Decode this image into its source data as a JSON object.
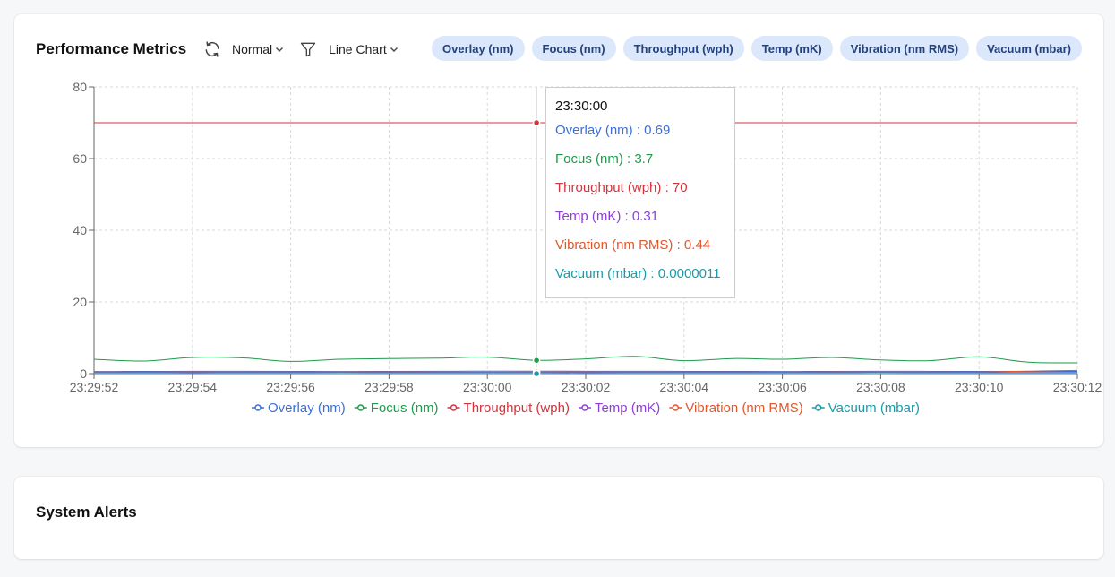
{
  "perf": {
    "title": "Performance Metrics",
    "mode_value": "Normal",
    "chart_type_value": "Line Chart",
    "chips": [
      "Overlay (nm)",
      "Focus (nm)",
      "Throughput (wph)",
      "Temp (mK)",
      "Vibration (nm RMS)",
      "Vacuum (mbar)"
    ]
  },
  "alerts": {
    "title": "System Alerts"
  },
  "icons": {
    "refresh": "refresh-icon",
    "filter": "filter-icon",
    "chevron": "chevron-down-icon"
  },
  "chart_data": {
    "type": "line",
    "x": [
      "23:29:52",
      "23:29:53",
      "23:29:54",
      "23:29:55",
      "23:29:56",
      "23:29:57",
      "23:29:58",
      "23:29:59",
      "23:30:00",
      "23:30:01",
      "23:30:02",
      "23:30:03",
      "23:30:04",
      "23:30:05",
      "23:30:06",
      "23:30:07",
      "23:30:08",
      "23:30:09",
      "23:30:10",
      "23:30:11",
      "23:30:12"
    ],
    "x_ticks": [
      "23:29:52",
      "23:29:54",
      "23:29:56",
      "23:29:58",
      "23:30:00",
      "23:30:02",
      "23:30:04",
      "23:30:06",
      "23:30:08",
      "23:30:10",
      "23:30:12"
    ],
    "ylim": [
      0,
      80
    ],
    "y_ticks": [
      0,
      20,
      40,
      60,
      80
    ],
    "grid": true,
    "legend_position": "bottom",
    "series": [
      {
        "name": "Overlay (nm)",
        "color": "#3b6fd6",
        "values": [
          0.6,
          0.62,
          0.65,
          0.66,
          0.64,
          0.6,
          0.63,
          0.66,
          0.68,
          0.69,
          0.67,
          0.66,
          0.64,
          0.62,
          0.6,
          0.63,
          0.65,
          0.64,
          0.62,
          0.61,
          0.62
        ]
      },
      {
        "name": "Focus (nm)",
        "color": "#1f9a4c",
        "values": [
          4.0,
          3.5,
          4.5,
          4.4,
          3.4,
          4.0,
          4.2,
          4.3,
          4.6,
          3.7,
          4.1,
          4.8,
          3.6,
          4.2,
          4.0,
          4.5,
          3.8,
          3.6,
          4.7,
          3.2,
          3.0
        ]
      },
      {
        "name": "Throughput (wph)",
        "color": "#d0343d",
        "values": [
          70,
          70,
          70,
          70,
          70,
          70,
          70,
          70,
          70,
          70,
          70,
          70,
          70,
          70,
          70,
          70,
          70,
          70,
          70,
          70,
          70
        ]
      },
      {
        "name": "Temp (mK)",
        "color": "#8d3ed6",
        "values": [
          0.3,
          0.32,
          0.29,
          0.31,
          0.3,
          0.33,
          0.31,
          0.3,
          0.32,
          0.31,
          0.29,
          0.3,
          0.32,
          0.31,
          0.3,
          0.31,
          0.33,
          0.3,
          0.31,
          0.3,
          0.32
        ]
      },
      {
        "name": "Vibration (nm RMS)",
        "color": "#e2572b",
        "values": [
          0.45,
          0.42,
          0.46,
          0.44,
          0.43,
          0.45,
          0.47,
          0.44,
          0.42,
          0.44,
          0.46,
          0.43,
          0.45,
          0.44,
          0.42,
          0.46,
          0.44,
          0.45,
          0.43,
          0.7,
          0.9
        ]
      },
      {
        "name": "Vacuum (mbar)",
        "color": "#1a9aa6",
        "values": [
          1.1e-06,
          1.1e-06,
          1.1e-06,
          1.1e-06,
          1.1e-06,
          1.1e-06,
          1.1e-06,
          1.1e-06,
          1.1e-06,
          1.1e-06,
          1.1e-06,
          1.1e-06,
          1.1e-06,
          1.1e-06,
          1.1e-06,
          1.1e-06,
          1.1e-06,
          1.1e-06,
          1.1e-06,
          1.1e-06,
          1.1e-06
        ]
      }
    ],
    "tooltip": {
      "time": "23:30:00",
      "index": 9,
      "rows": [
        {
          "text": "Overlay (nm) : 0.69",
          "color": "#3b6fd6"
        },
        {
          "text": "Focus (nm) : 3.7",
          "color": "#1f9a4c"
        },
        {
          "text": "Throughput (wph) : 70",
          "color": "#d0343d"
        },
        {
          "text": "Temp (mK) : 0.31",
          "color": "#8d3ed6"
        },
        {
          "text": "Vibration (nm RMS) : 0.44",
          "color": "#e2572b"
        },
        {
          "text": "Vacuum (mbar) : 0.0000011",
          "color": "#1a9aa6"
        }
      ]
    }
  }
}
